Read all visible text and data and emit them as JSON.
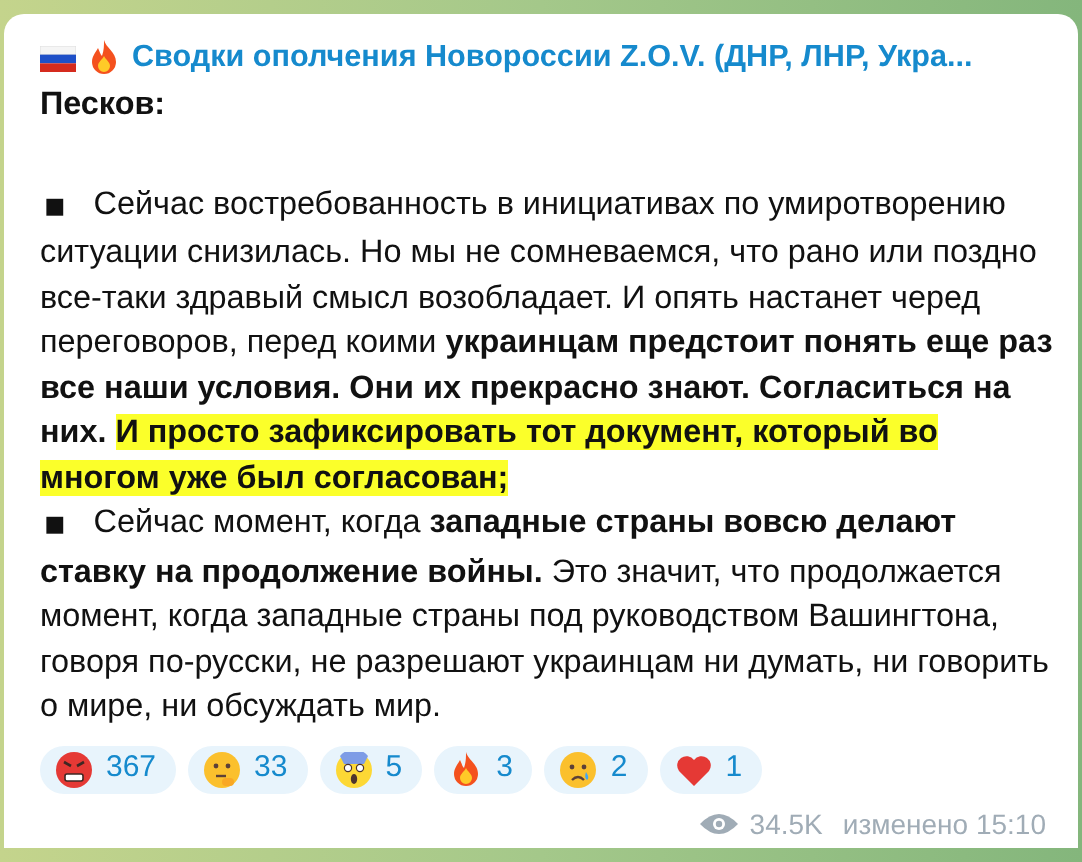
{
  "channel": {
    "name": "Сводки ополчения Новороссии Z.O.V. (ДНР, ЛНР, Укра..."
  },
  "heading": "Песков:",
  "paragraphs": [
    {
      "bullet": "◼",
      "segments": [
        {
          "text": "Сейчас востребованность в инициативах по умиротворению ситуации снизилась. Но мы не сомневаемся, что рано или поздно все-таки здравый смысл возобладает. И опять настанет черед переговоров, перед коими ",
          "bold": false,
          "highlight": false
        },
        {
          "text": "украинцам предстоит понять еще раз все наши условия. Они их прекрасно знают. Согласиться на них. ",
          "bold": true,
          "highlight": false
        },
        {
          "text": "И просто зафиксировать тот документ, который во многом уже был согласован;",
          "bold": true,
          "highlight": true
        }
      ]
    },
    {
      "bullet": "◼",
      "segments": [
        {
          "text": "Сейчас момент, когда ",
          "bold": false,
          "highlight": false
        },
        {
          "text": "западные страны вовсю делают ставку на продолжение войны.",
          "bold": true,
          "highlight": false
        },
        {
          "text": " Это значит, что продолжается момент, когда западные страны под руководством Вашингтона, говоря по-русски, не разрешают украинцам ни думать, ни говорить о мире, ни обсуждать мир.",
          "bold": false,
          "highlight": false
        }
      ]
    }
  ],
  "reactions": [
    {
      "kind": "angry",
      "count": "367"
    },
    {
      "kind": "thinking",
      "count": "33"
    },
    {
      "kind": "scream",
      "count": "5"
    },
    {
      "kind": "fire",
      "count": "3"
    },
    {
      "kind": "cry",
      "count": "2"
    },
    {
      "kind": "heart",
      "count": "1"
    }
  ],
  "footer": {
    "views": "34.5K",
    "edited": "изменено 15:10"
  }
}
